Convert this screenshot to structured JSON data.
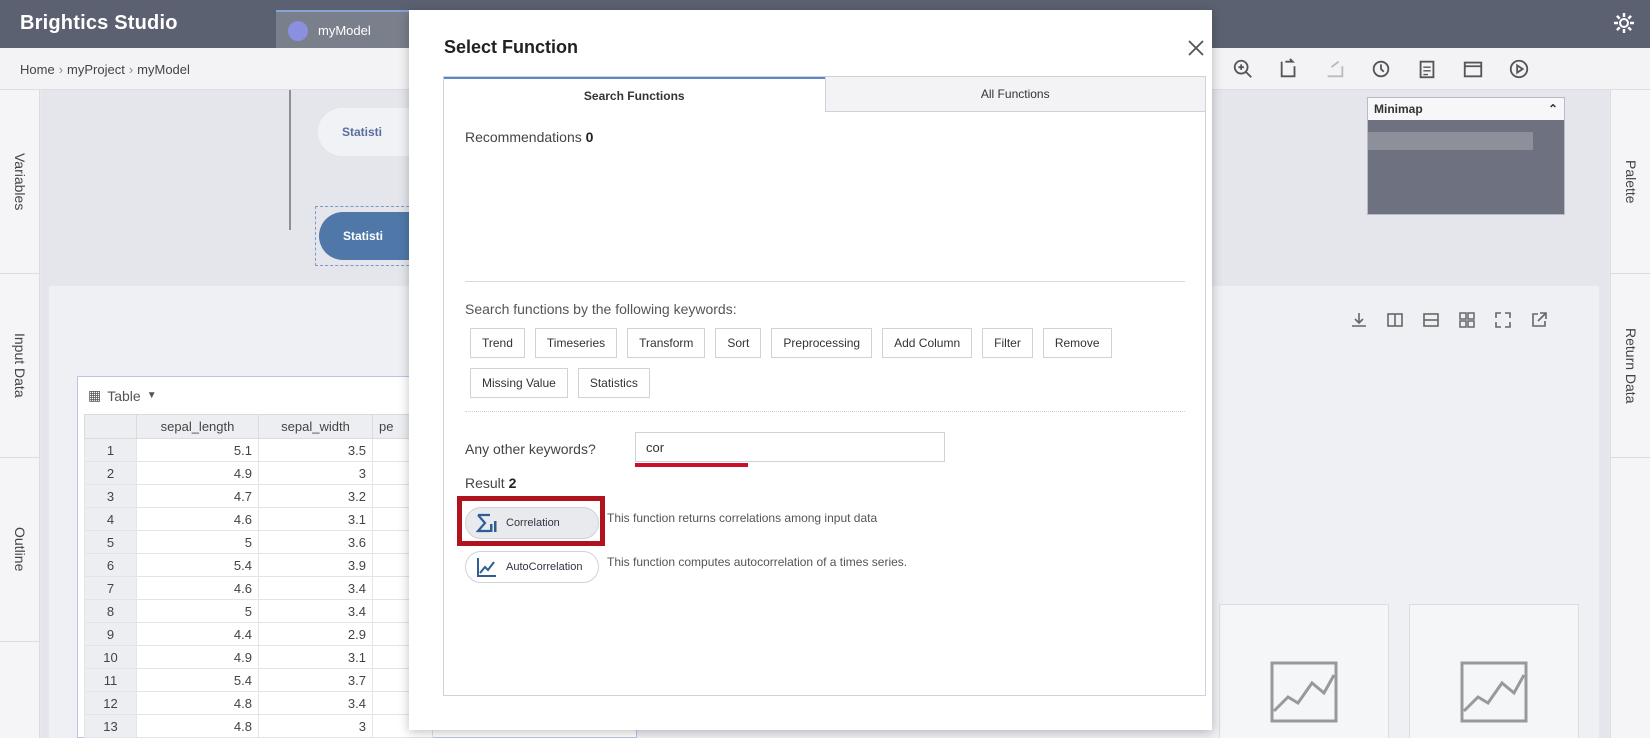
{
  "app": {
    "title": "Brightics Studio",
    "tab_label": "myModel"
  },
  "breadcrumb": [
    "Home",
    "myProject",
    "myModel"
  ],
  "rails": {
    "left": [
      "Variables",
      "Input Data",
      "Outline"
    ],
    "right": [
      "Palette",
      "Return Data"
    ]
  },
  "canvas": {
    "node_label": "Statisti",
    "minimap_title": "Minimap"
  },
  "table": {
    "view_label": "Table",
    "columns": [
      "",
      "sepal_length",
      "sepal_width",
      "pe"
    ],
    "rows": [
      [
        "1",
        "5.1",
        "3.5"
      ],
      [
        "2",
        "4.9",
        "3"
      ],
      [
        "3",
        "4.7",
        "3.2"
      ],
      [
        "4",
        "4.6",
        "3.1"
      ],
      [
        "5",
        "5",
        "3.6"
      ],
      [
        "6",
        "5.4",
        "3.9"
      ],
      [
        "7",
        "4.6",
        "3.4"
      ],
      [
        "8",
        "5",
        "3.4"
      ],
      [
        "9",
        "4.4",
        "2.9"
      ],
      [
        "10",
        "4.9",
        "3.1"
      ],
      [
        "11",
        "5.4",
        "3.7"
      ],
      [
        "12",
        "4.8",
        "3.4"
      ],
      [
        "13",
        "4.8",
        "3"
      ]
    ]
  },
  "modal": {
    "title": "Select Function",
    "tabs": [
      "Search Functions",
      "All Functions"
    ],
    "recommendations_label": "Recommendations",
    "recommendations_count": "0",
    "keywords_title": "Search functions by the following keywords:",
    "keywords_row1": [
      "Trend",
      "Timeseries",
      "Transform",
      "Sort",
      "Preprocessing",
      "Add Column",
      "Filter",
      "Remove"
    ],
    "keywords_row2": [
      "Missing Value",
      "Statistics"
    ],
    "other_label": "Any other keywords?",
    "other_value": "cor",
    "result_label": "Result",
    "result_count": "2",
    "results": [
      {
        "name": "Correlation",
        "desc": "This function returns correlations among input data",
        "icon": "sigma-chart-icon"
      },
      {
        "name": "AutoCorrelation",
        "desc": "This function computes autocorrelation of a times series.",
        "icon": "line-chart-icon"
      }
    ]
  },
  "colors": {
    "highlight": "#b0121e",
    "underline": "#c8102e",
    "accent": "#5d86c9",
    "node_active": "#4f78a8"
  }
}
